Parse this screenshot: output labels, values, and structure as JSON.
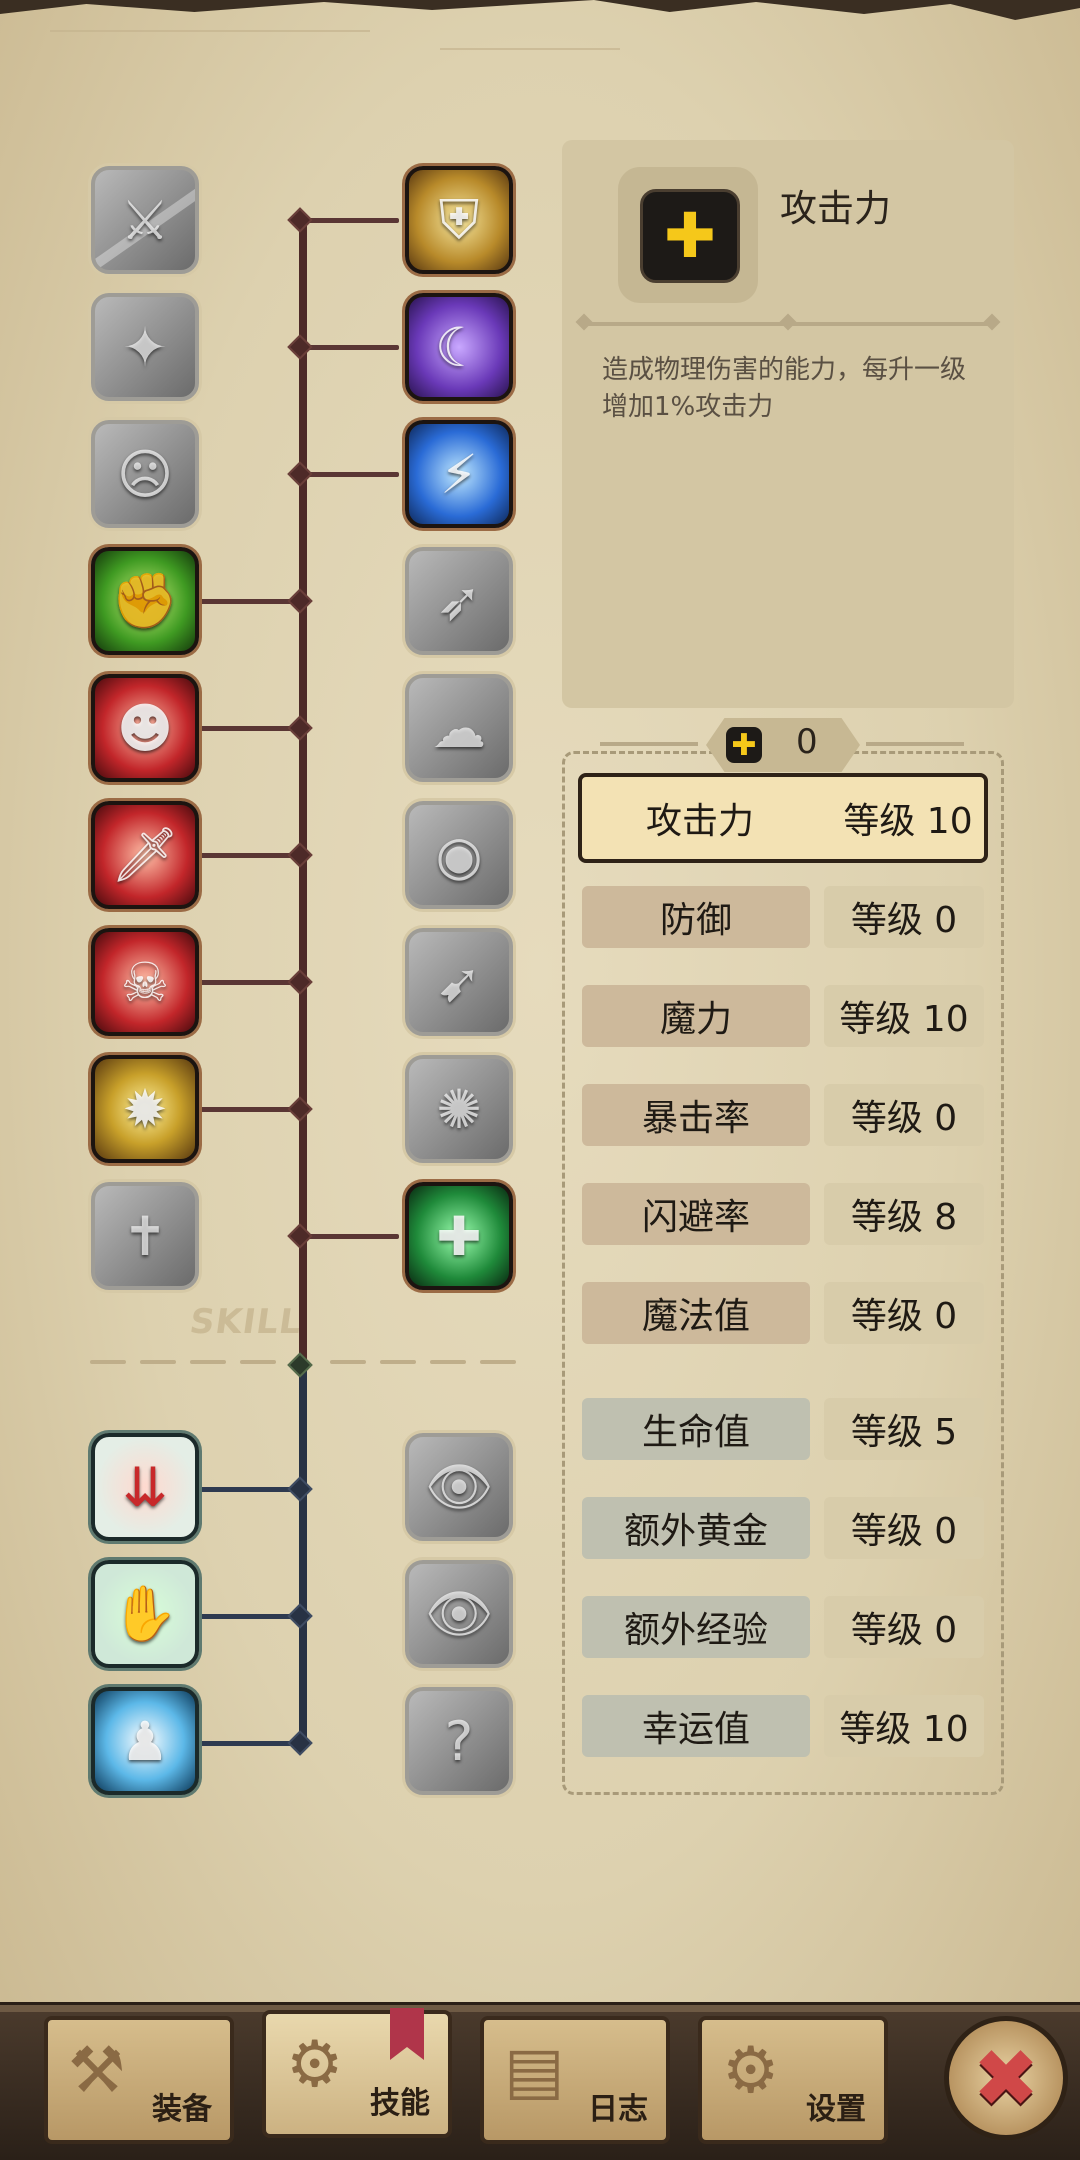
{
  "info": {
    "title": "攻击力",
    "description": "造成物理伤害的能力，每升一级增加1%攻击力",
    "icon": "plus-icon"
  },
  "points": {
    "value": "0",
    "icon": "plus-icon"
  },
  "stats": [
    {
      "name": "攻击力",
      "level": "等级 10",
      "selected": true
    },
    {
      "name": "防御",
      "level": "等级 0"
    },
    {
      "name": "魔力",
      "level": "等级 10"
    },
    {
      "name": "暴击率",
      "level": "等级 0"
    },
    {
      "name": "闪避率",
      "level": "等级 8"
    },
    {
      "name": "魔法值",
      "level": "等级 0"
    },
    {
      "name": "生命值",
      "level": "等级 5"
    },
    {
      "name": "额外黄金",
      "level": "等级 0"
    },
    {
      "name": "额外经验",
      "level": "等级 0"
    },
    {
      "name": "幸运值",
      "level": "等级 10"
    }
  ],
  "tree": {
    "watermark": "SKILL",
    "left": [
      "locked",
      "locked",
      "locked",
      "unlocked",
      "unlocked",
      "unlocked",
      "unlocked",
      "unlocked",
      "locked"
    ],
    "right": [
      "unlocked",
      "unlocked",
      "unlocked",
      "locked",
      "locked",
      "locked",
      "locked",
      "locked",
      "unlocked"
    ],
    "lower_left": [
      "unlocked",
      "unlocked",
      "unlocked"
    ],
    "lower_right": [
      "locked",
      "locked",
      "locked"
    ]
  },
  "nav": {
    "tabs": [
      {
        "label": "装备",
        "icon": "axe-icon"
      },
      {
        "label": "技能",
        "icon": "gear-icon",
        "active": true
      },
      {
        "label": "日志",
        "icon": "book-icon"
      },
      {
        "label": "设置",
        "icon": "settings-icon"
      }
    ],
    "close_icon": "close-icon"
  },
  "colors": {
    "parchment": "#ddd0ae",
    "tree_upper": "#4d2a28",
    "tree_lower": "#283244",
    "accent_yellow": "#f5c81a",
    "close_red": "#d04848"
  }
}
